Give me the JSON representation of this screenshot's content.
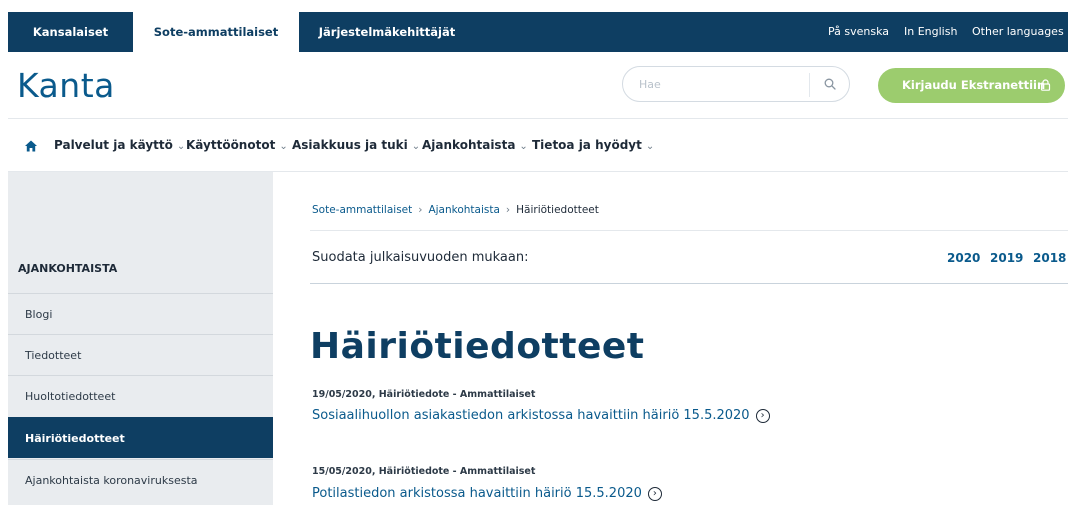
{
  "topbar": {
    "tabs": [
      "Kansalaiset",
      "Sote-ammattilaiset",
      "Järjestelmäkehittäjät"
    ],
    "languages": [
      "På svenska",
      "In English",
      "Other languages"
    ]
  },
  "header": {
    "logo": "Kanta",
    "search_placeholder": "Hae",
    "login_label": "Kirjaudu Ekstranettiin"
  },
  "nav": {
    "items": [
      "Palvelut ja käyttö",
      "Käyttöönotot",
      "Asiakkuus ja tuki",
      "Ajankohtaista",
      "Tietoa ja hyödyt"
    ],
    "chevron": "⌄"
  },
  "sidebar": {
    "heading": "AJANKOHTAISTA",
    "items": [
      "Blogi",
      "Tiedotteet",
      "Huoltotiedotteet",
      "Häiriötiedotteet",
      "Ajankohtaista koronaviruksesta"
    ],
    "active_index": 3
  },
  "breadcrumb": {
    "items": [
      "Sote-ammattilaiset",
      "Ajankohtaista",
      "Häiriötiedotteet"
    ],
    "separator": "›"
  },
  "filter": {
    "label": "Suodata julkaisuvuoden mukaan:",
    "years": [
      "2020",
      "2019",
      "2018"
    ]
  },
  "page_title": "Häiriötiedotteet",
  "articles": [
    {
      "meta": "19/05/2020, Häiriötiedote - Ammattilaiset",
      "title": "Sosiaalihuollon asiakastiedon arkistossa havaittiin häiriö 15.5.2020"
    },
    {
      "meta": "15/05/2020, Häiriötiedote - Ammattilaiset",
      "title": "Potilastiedon arkistossa havaittiin häiriö 15.5.2020"
    }
  ],
  "colors": {
    "brand_dark": "#0e3e62",
    "link_blue": "#0a5a8c",
    "login_green": "#9ccc6e",
    "sidebar_bg": "#e9ecef"
  },
  "icons": [
    "home-icon",
    "search-icon",
    "lock-icon",
    "chevron-down-icon",
    "arrow-circle-right-icon"
  ]
}
